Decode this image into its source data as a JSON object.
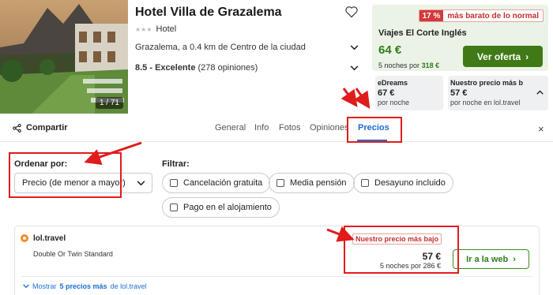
{
  "hotel": {
    "name": "Hotel Villa de Grazalema",
    "stars_icon": "★★★",
    "type": "Hotel",
    "location": "Grazalema, a 0.4 km de Centro de la ciudad",
    "rating": "8.5 - Excelente",
    "reviews": "(278 opiniones)",
    "photo_counter": "1 / 71"
  },
  "deal": {
    "percent": "17 %",
    "badge_text": "más barato de lo normal",
    "provider": "Viajes El Corte Inglés",
    "price": "64 €",
    "nights_prefix": "5 noches por",
    "nights_total": "318 €",
    "button": "Ver oferta",
    "button_icon": "›"
  },
  "alternatives": [
    {
      "name": "eDreams",
      "price": "67 €",
      "sub": "por noche"
    },
    {
      "name": "Nuestro precio más b",
      "price": "57 €",
      "sub": "por noche en lol.travel"
    }
  ],
  "tabs": {
    "share": "Compartir",
    "items": [
      "General",
      "Info",
      "Fotos",
      "Opiniones",
      "Precios"
    ],
    "close": "×"
  },
  "sort": {
    "label": "Ordenar por:",
    "value": "Precio (de menor a mayor)"
  },
  "filter": {
    "label": "Filtrar:",
    "chips": [
      "Cancelación gratuita",
      "Media pensión",
      "Desayuno incluido",
      "Pago en el alojamiento"
    ]
  },
  "offer": {
    "provider": "lol.travel",
    "room": "Double Or Twin Standard",
    "badge": "Nuestro precio más bajo",
    "price": "57 €",
    "nights": "5 noches por 286 €",
    "button": "Ir a la web",
    "button_icon": "›",
    "more_prefix": "Mostrar",
    "more_bold": "5 precios más",
    "more_suffix": "de lol.travel"
  },
  "colors": {
    "accent": "#1b6ed1",
    "deal_green": "#3f7a17",
    "alert_red": "#d33a3a",
    "annotation_red": "#e01c1c"
  }
}
